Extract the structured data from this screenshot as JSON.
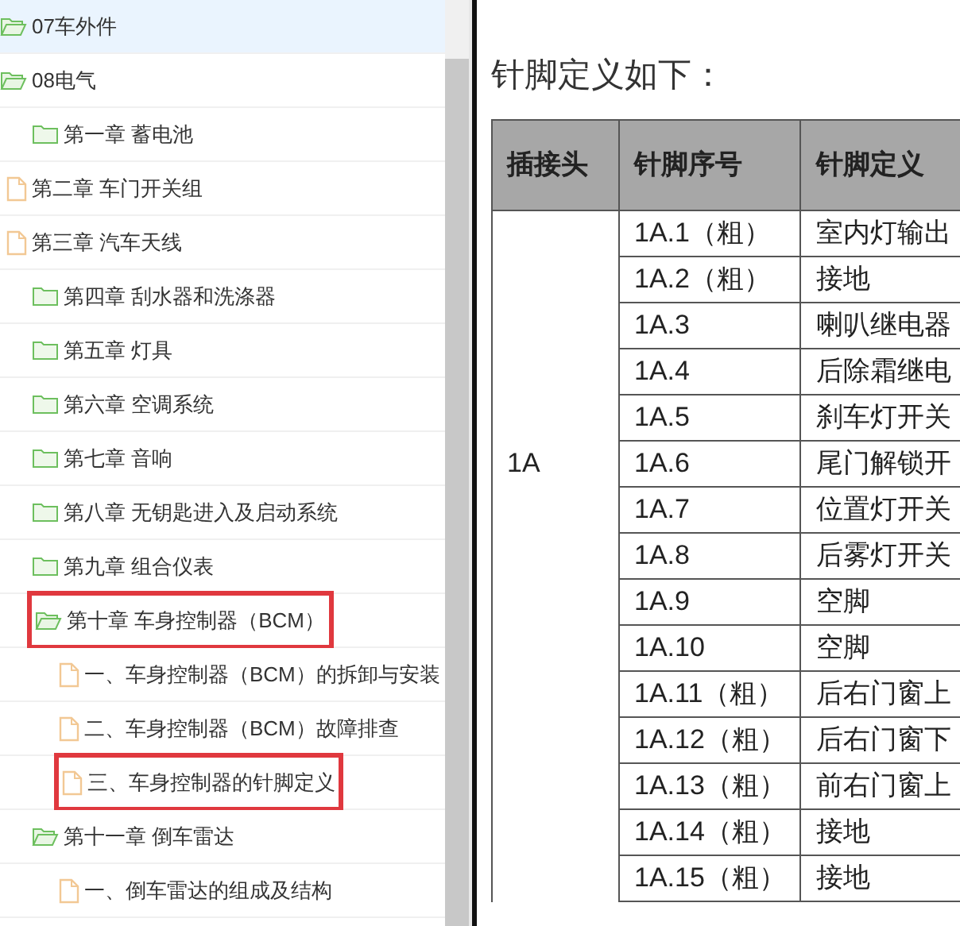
{
  "tree": [
    {
      "label": "07车外件",
      "kind": "folder",
      "expanded": true,
      "selected": true,
      "highlighted": false
    },
    {
      "label": "08电气",
      "kind": "folder",
      "expanded": true,
      "selected": false,
      "highlighted": false,
      "children": [
        {
          "label": "第一章 蓄电池",
          "kind": "folder",
          "expanded": false,
          "selected": false,
          "highlighted": false
        },
        {
          "label": "第二章 车门开关组",
          "kind": "file",
          "selected": false,
          "highlighted": false
        },
        {
          "label": "第三章 汽车天线",
          "kind": "file",
          "selected": false,
          "highlighted": false
        },
        {
          "label": "第四章 刮水器和洗涤器",
          "kind": "folder",
          "expanded": false,
          "selected": false,
          "highlighted": false
        },
        {
          "label": "第五章 灯具",
          "kind": "folder",
          "expanded": false,
          "selected": false,
          "highlighted": false
        },
        {
          "label": "第六章 空调系统",
          "kind": "folder",
          "expanded": false,
          "selected": false,
          "highlighted": false
        },
        {
          "label": "第七章 音响",
          "kind": "folder",
          "expanded": false,
          "selected": false,
          "highlighted": false
        },
        {
          "label": "第八章 无钥匙进入及启动系统",
          "kind": "folder",
          "expanded": false,
          "selected": false,
          "highlighted": false
        },
        {
          "label": "第九章 组合仪表",
          "kind": "folder",
          "expanded": false,
          "selected": false,
          "highlighted": false
        },
        {
          "label": "第十章 车身控制器（BCM）",
          "kind": "folder",
          "expanded": true,
          "selected": false,
          "highlighted": true,
          "children": [
            {
              "label": "一、车身控制器（BCM）的拆卸与安装",
              "kind": "file",
              "selected": false,
              "highlighted": false
            },
            {
              "label": "二、车身控制器（BCM）故障排查",
              "kind": "file",
              "selected": false,
              "highlighted": false
            },
            {
              "label": "三、车身控制器的针脚定义",
              "kind": "file",
              "selected": false,
              "highlighted": true
            }
          ]
        },
        {
          "label": "第十一章 倒车雷达",
          "kind": "folder",
          "expanded": true,
          "selected": false,
          "highlighted": false,
          "children": [
            {
              "label": "一、倒车雷达的组成及结构",
              "kind": "file",
              "selected": false,
              "highlighted": false
            }
          ]
        }
      ]
    }
  ],
  "document": {
    "heading": "针脚定义如下：",
    "table": {
      "columns": [
        "插接头",
        "针脚序号",
        "针脚定义"
      ],
      "rows": [
        [
          "",
          "1A.1（粗）",
          "室内灯输出"
        ],
        [
          "",
          "1A.2（粗）",
          "接地"
        ],
        [
          "",
          "1A.3",
          "喇叭继电器"
        ],
        [
          "",
          "1A.4",
          "后除霜继电"
        ],
        [
          "",
          "1A.5",
          "刹车灯开关"
        ],
        [
          "1A",
          "1A.6",
          "尾门解锁开"
        ],
        [
          "",
          "1A.7",
          "位置灯开关"
        ],
        [
          "",
          "1A.8",
          "后雾灯开关"
        ],
        [
          "",
          "1A.9",
          "空脚"
        ],
        [
          "",
          "1A.10",
          "空脚"
        ],
        [
          "",
          "1A.11（粗）",
          "后右门窗上"
        ],
        [
          "",
          "1A.12（粗）",
          "后右门窗下"
        ],
        [
          "",
          "1A.13（粗）",
          "前右门窗上"
        ],
        [
          "",
          "1A.14（粗）",
          "接地"
        ],
        [
          "",
          "1A.15（粗）",
          "接地"
        ]
      ]
    }
  }
}
